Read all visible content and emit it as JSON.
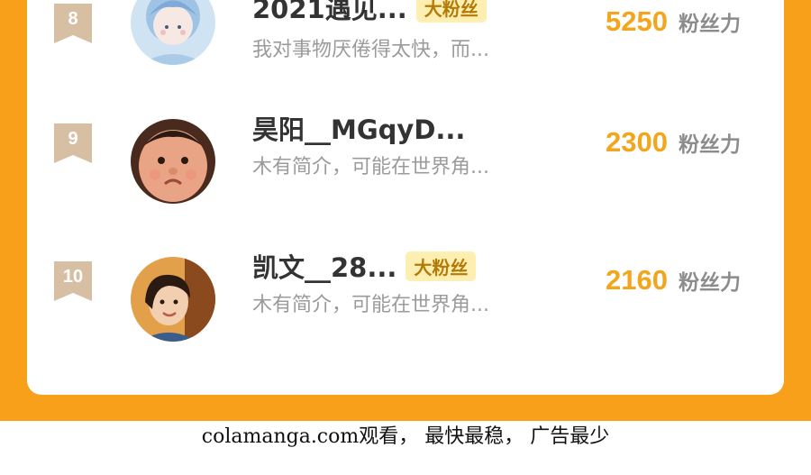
{
  "ranking": {
    "rows": [
      {
        "rank": "8",
        "name": "2021遇见...",
        "badge": "大粉丝",
        "intro": "我对事物厌倦得太快，而...",
        "score": "5250",
        "unit": "粉丝力"
      },
      {
        "rank": "9",
        "name": "昊阳__MGqyD...",
        "badge": "",
        "intro": "木有简介，可能在世界角...",
        "score": "2300",
        "unit": "粉丝力"
      },
      {
        "rank": "10",
        "name": "凯文__28...",
        "badge": "大粉丝",
        "intro": "木有简介，可能在世界角...",
        "score": "2160",
        "unit": "粉丝力"
      }
    ]
  },
  "footer": {
    "text": "colamanga.com观看， 最快最稳， 广告最少"
  },
  "colors": {
    "accent": "#f9a01b",
    "badge_bg": "#fdefb2",
    "score": "#f3a51c",
    "rank_ribbon": "#d7bfa4"
  }
}
